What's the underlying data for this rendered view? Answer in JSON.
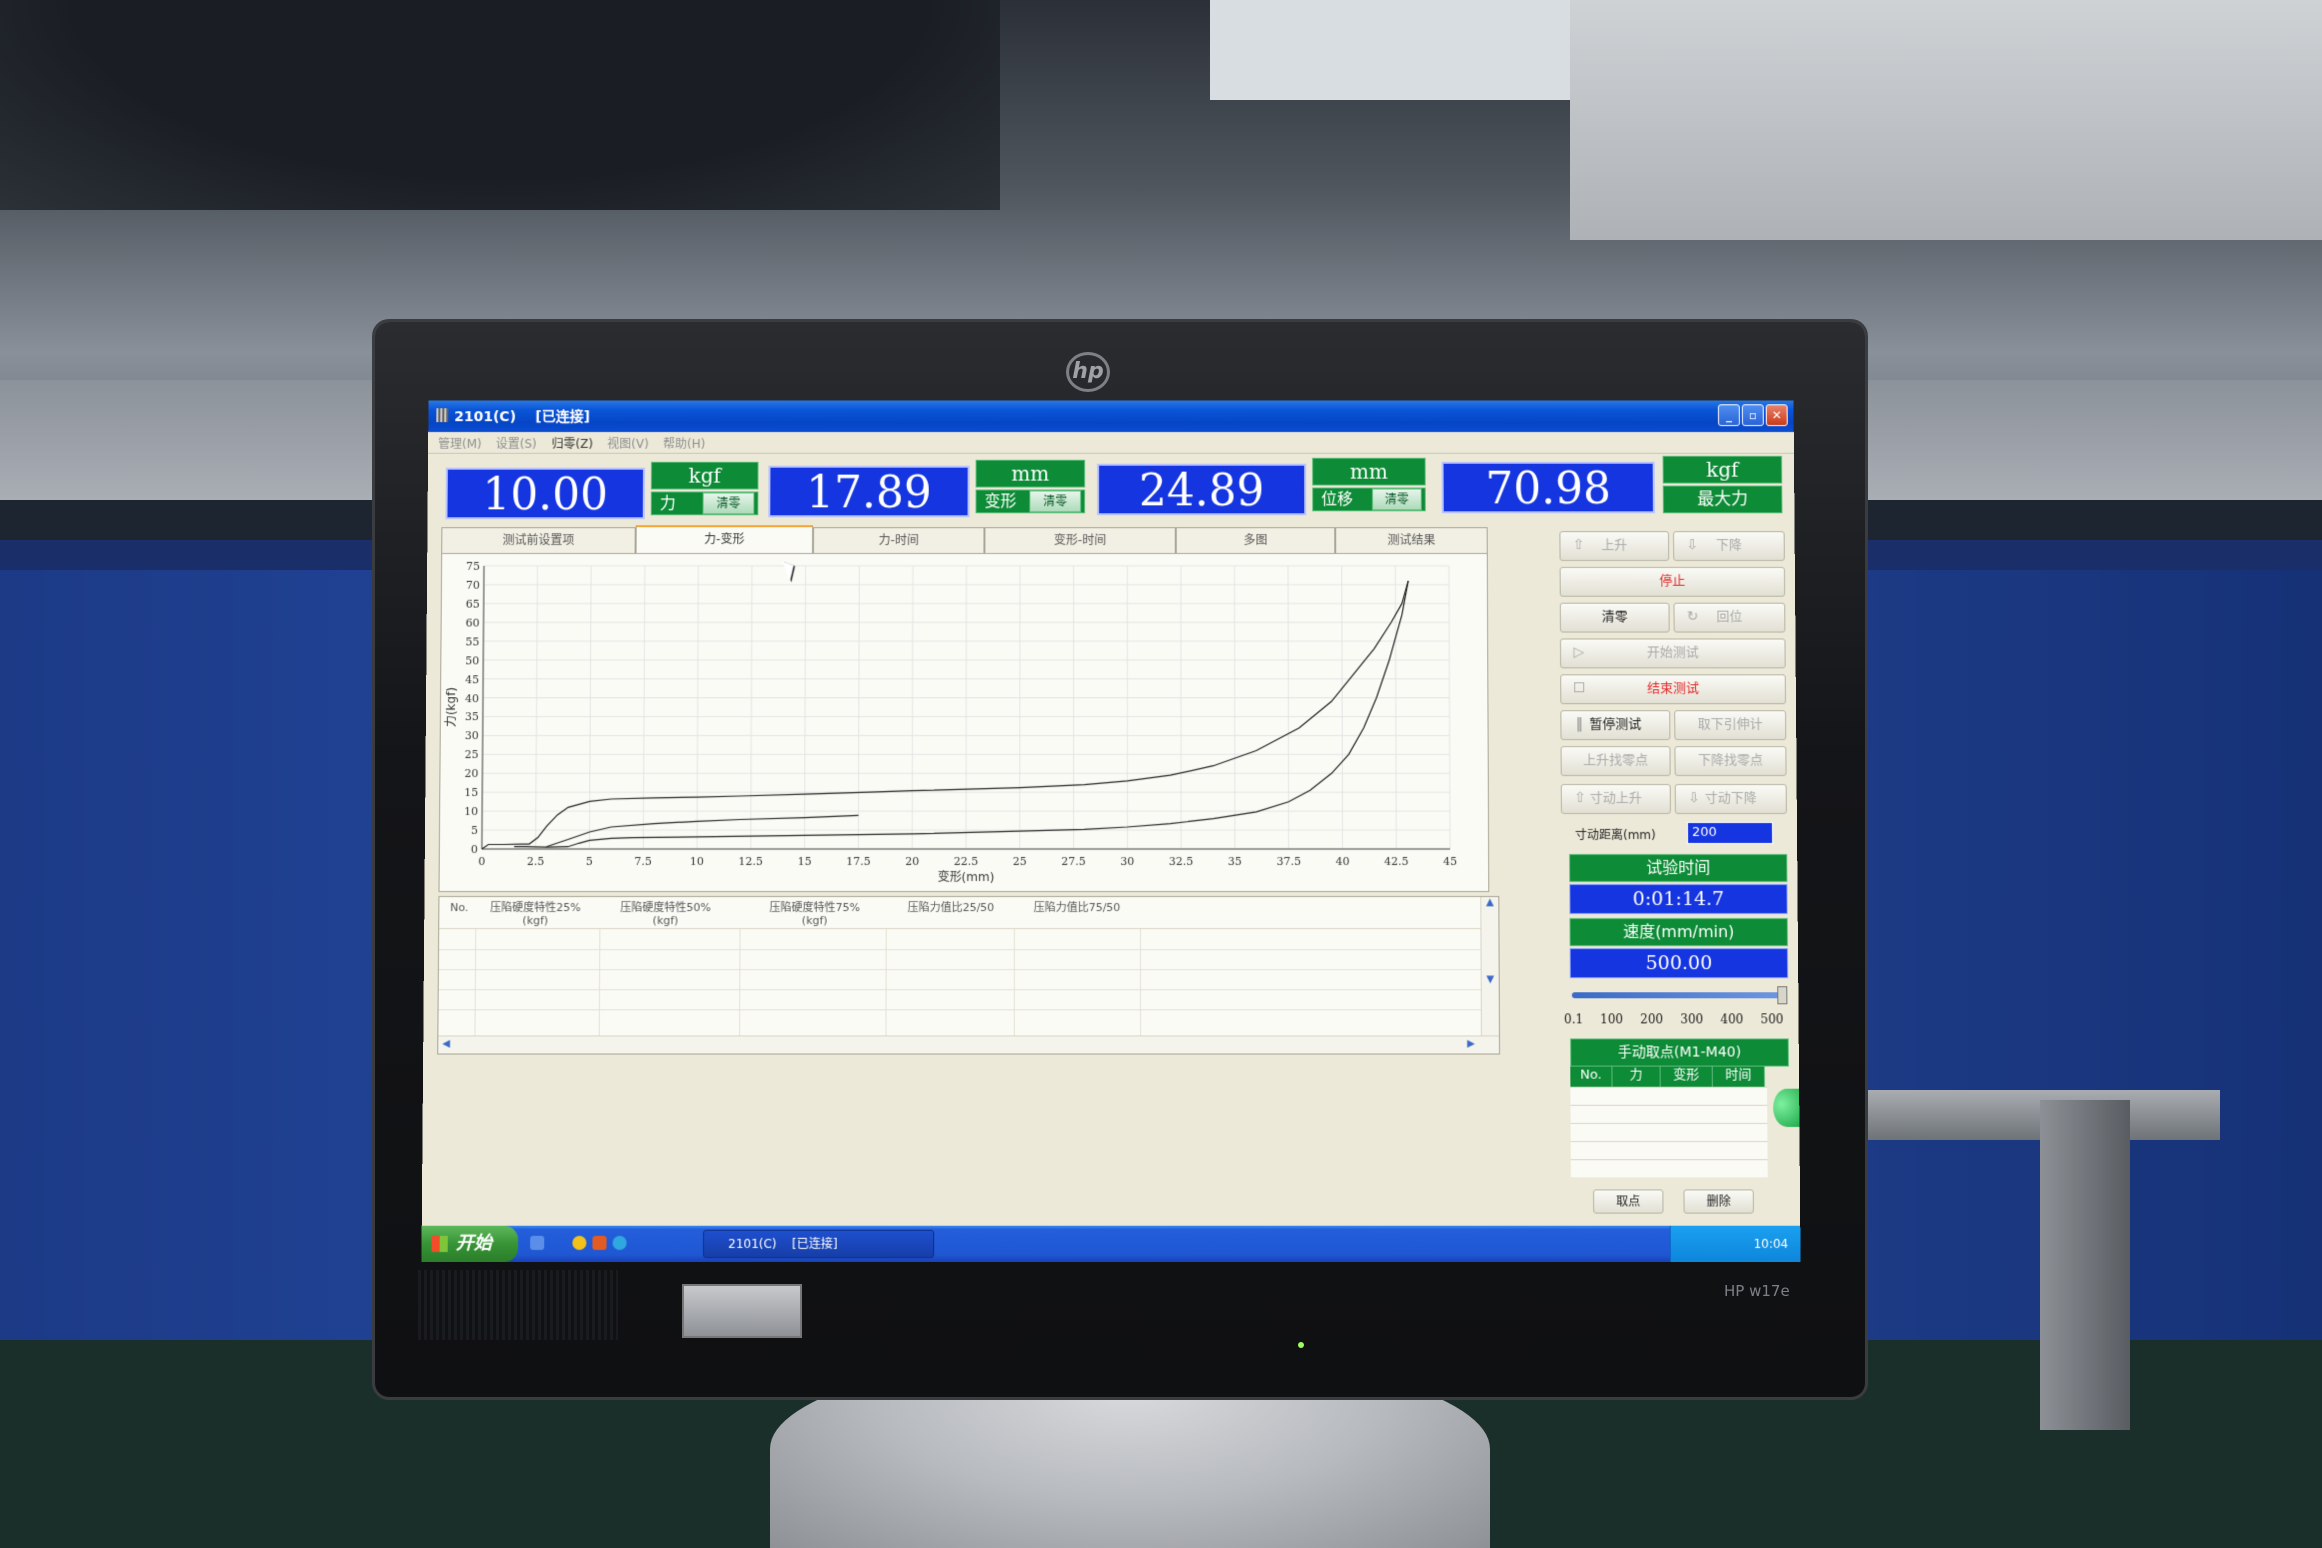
{
  "window": {
    "title": "2101(C)    [已连接]",
    "minimize": "_",
    "maximize": "▫",
    "close": "✕"
  },
  "menu": [
    {
      "label": "管理(M)",
      "enabled": false
    },
    {
      "label": "设置(S)",
      "enabled": false
    },
    {
      "label": "归零(Z)",
      "enabled": true
    },
    {
      "label": "视图(V)",
      "enabled": false
    },
    {
      "label": "帮助(H)",
      "enabled": false
    }
  ],
  "readouts": {
    "force": {
      "value": "10.00",
      "unit": "kgf",
      "label": "力",
      "clear": "清零"
    },
    "deformation": {
      "value": "17.89",
      "unit": "mm",
      "label": "变形",
      "clear": "清零"
    },
    "displacement": {
      "value": "24.89",
      "unit": "mm",
      "label": "位移",
      "clear": "清零"
    },
    "max_force": {
      "value": "70.98",
      "unit": "kgf",
      "label": "最大力"
    }
  },
  "tabs": [
    {
      "label": "测试前设置项",
      "active": false
    },
    {
      "label": "力-变形",
      "active": true
    },
    {
      "label": "力-时间",
      "active": false
    },
    {
      "label": "变形-时间",
      "active": false
    },
    {
      "label": "多图",
      "active": false
    },
    {
      "label": "测试结果",
      "active": false
    }
  ],
  "chart_data": {
    "type": "line",
    "xlabel": "变形(mm)",
    "ylabel": "力(kgf)",
    "xlim": [
      0,
      45
    ],
    "ylim": [
      0,
      75
    ],
    "x_ticks": [
      0,
      2.5,
      5,
      7.5,
      10,
      12.5,
      15,
      17.5,
      20,
      22.5,
      25,
      27.5,
      30,
      32.5,
      35,
      37.5,
      40,
      42.5,
      45
    ],
    "y_ticks": [
      0,
      5,
      10,
      15,
      20,
      25,
      30,
      35,
      40,
      45,
      50,
      55,
      60,
      65,
      70,
      75
    ],
    "grid": true,
    "series": [
      {
        "x": [
          0,
          0.3,
          1,
          1.8,
          2.2,
          2.6,
          3,
          3.5,
          4,
          5,
          6,
          8,
          10,
          12,
          15,
          18,
          20,
          25,
          28,
          30,
          32,
          34,
          36,
          38,
          39.5,
          40.5,
          41.5,
          42.3,
          42.8,
          43.1
        ],
        "y": [
          0,
          1.2,
          1.2,
          1.3,
          1.3,
          3,
          6,
          9,
          11,
          12.6,
          13.2,
          13.5,
          13.7,
          14,
          14.5,
          15,
          15.4,
          16.2,
          17,
          18,
          19.5,
          22,
          26,
          32,
          39,
          46,
          53,
          60,
          65,
          71
        ]
      },
      {
        "x": [
          43.1,
          42.8,
          42.2,
          41.6,
          41,
          40.3,
          39.5,
          38.5,
          37.5,
          36,
          34,
          32,
          30,
          28,
          25,
          20,
          15,
          10,
          7,
          6,
          5,
          4.5,
          4,
          3,
          2,
          1.5
        ],
        "y": [
          71,
          62,
          50,
          40,
          32,
          25,
          20,
          15.5,
          12.5,
          9.8,
          8,
          6.7,
          5.8,
          5.2,
          4.7,
          4,
          3.6,
          3.2,
          3,
          2.8,
          2.3,
          1.5,
          0.6,
          0.5,
          0.6,
          0.6
        ]
      },
      {
        "x": [
          3,
          4,
          5,
          6,
          8,
          10,
          12,
          15,
          17.5
        ],
        "y": [
          0.6,
          2.5,
          4.5,
          5.8,
          6.7,
          7.3,
          7.8,
          8.3,
          8.9
        ]
      }
    ]
  },
  "results_table": {
    "columns": [
      {
        "l1": "No.",
        "l2": ""
      },
      {
        "l1": "压陷硬度特性25%",
        "l2": "(kgf)"
      },
      {
        "l1": "压陷硬度特性50%",
        "l2": "(kgf)"
      },
      {
        "l1": "压陷硬度特性75%",
        "l2": "(kgf)"
      },
      {
        "l1": "压陷力值比25/50",
        "l2": ""
      },
      {
        "l1": "压陷力值比75/50",
        "l2": ""
      }
    ]
  },
  "control": {
    "up": "上升",
    "down": "下降",
    "stop": "停止",
    "zero": "清零",
    "return": "回位",
    "start_test": "开始测试",
    "end_test": "结束测试",
    "pause_test": "暂停测试",
    "remove_extensometer": "取下引伸计",
    "up_find_zero": "上升找零点",
    "down_find_zero": "下降找零点",
    "jog_up": "寸动上升",
    "jog_down": "寸动下降",
    "jog_distance_label": "寸动距离(mm)",
    "jog_distance_value": "200"
  },
  "status": {
    "time_label": "试验时间",
    "time_value": "0:01:14.7",
    "speed_label": "速度(mm/min)",
    "speed_value": "500.00",
    "speed_level": 0.99,
    "speed_scale": [
      "0.1",
      "100",
      "200",
      "300",
      "400",
      "500"
    ]
  },
  "manual_points": {
    "title": "手动取点(M1-M40)",
    "columns": [
      "No.",
      "力",
      "变形",
      "时间"
    ],
    "take_point": "取点",
    "delete": "删除"
  },
  "taskbar": {
    "start": "开始",
    "task": "2101(C)    [已连接]",
    "clock": "10:04"
  },
  "monitor": {
    "brand": "hp",
    "model": "HP w17e"
  }
}
